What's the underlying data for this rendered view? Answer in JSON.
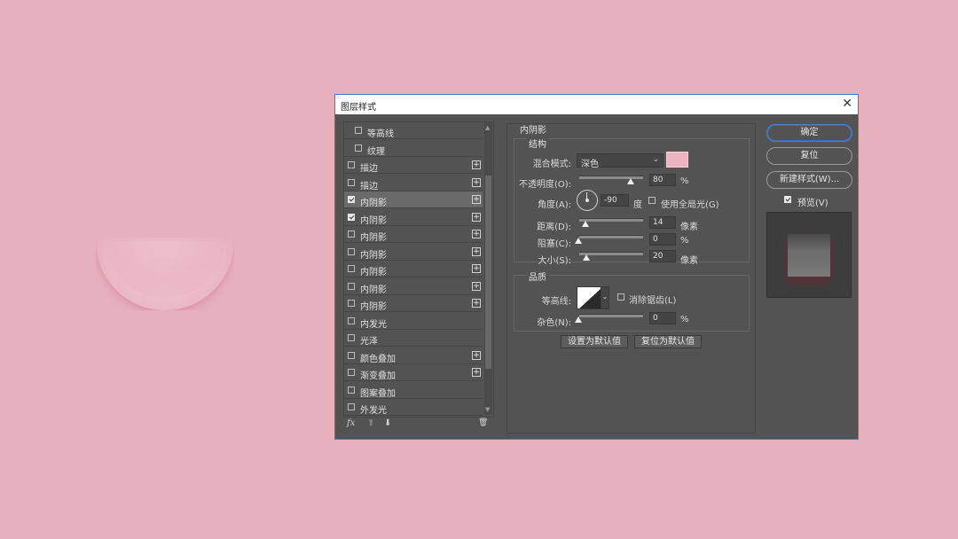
{
  "dialog": {
    "title": "图层样式",
    "close_glyph": "✕"
  },
  "style_list": {
    "items": [
      {
        "label": "等高线",
        "checked": false,
        "indent": true,
        "plus": false,
        "selected": false
      },
      {
        "label": "纹理",
        "checked": false,
        "indent": true,
        "plus": false,
        "selected": false
      },
      {
        "label": "描边",
        "checked": false,
        "indent": false,
        "plus": true,
        "selected": false
      },
      {
        "label": "描边",
        "checked": false,
        "indent": false,
        "plus": true,
        "selected": false
      },
      {
        "label": "内阴影",
        "checked": true,
        "indent": false,
        "plus": true,
        "selected": true
      },
      {
        "label": "内阴影",
        "checked": true,
        "indent": false,
        "plus": true,
        "selected": false
      },
      {
        "label": "内阴影",
        "checked": false,
        "indent": false,
        "plus": true,
        "selected": false
      },
      {
        "label": "内阴影",
        "checked": false,
        "indent": false,
        "plus": true,
        "selected": false
      },
      {
        "label": "内阴影",
        "checked": false,
        "indent": false,
        "plus": true,
        "selected": false
      },
      {
        "label": "内阴影",
        "checked": false,
        "indent": false,
        "plus": true,
        "selected": false
      },
      {
        "label": "内阴影",
        "checked": false,
        "indent": false,
        "plus": true,
        "selected": false
      },
      {
        "label": "内发光",
        "checked": false,
        "indent": false,
        "plus": false,
        "selected": false
      },
      {
        "label": "光泽",
        "checked": false,
        "indent": false,
        "plus": false,
        "selected": false
      },
      {
        "label": "颜色叠加",
        "checked": false,
        "indent": false,
        "plus": true,
        "selected": false
      },
      {
        "label": "渐变叠加",
        "checked": false,
        "indent": false,
        "plus": true,
        "selected": false
      },
      {
        "label": "图案叠加",
        "checked": false,
        "indent": false,
        "plus": false,
        "selected": false
      },
      {
        "label": "外发光",
        "checked": false,
        "indent": false,
        "plus": false,
        "selected": false
      }
    ],
    "plus_glyph": "+",
    "footer": {
      "fx_label": "fx",
      "up_glyph": "⬆",
      "down_glyph": "⬇",
      "trash_glyph": "🗑"
    }
  },
  "inner_shadow": {
    "heading": "内阴影",
    "structure_heading": "结构",
    "blend_mode_label": "混合模式:",
    "blend_mode_value": "深色",
    "shadow_color": "#efb3bf",
    "opacity_label": "不透明度(O):",
    "opacity_value": "80",
    "opacity_fraction": 0.8,
    "percent": "%",
    "angle_label": "角度(A):",
    "angle_value": "-90",
    "degree_unit": "度",
    "global_light_label": "使用全局光(G)",
    "distance_label": "距离(D):",
    "distance_value": "14",
    "choke_label": "阻塞(C):",
    "choke_value": "0",
    "size_label": "大小(S):",
    "size_value": "20",
    "pixel_unit": "像素",
    "quality_heading": "品质",
    "contour_label": "等高线:",
    "anti_alias_label": "消除锯齿(L)",
    "noise_label": "杂色(N):",
    "noise_value": "0",
    "set_default_label": "设置为默认值",
    "reset_default_label": "复位为默认值"
  },
  "right": {
    "ok_label": "确定",
    "reset_label": "复位",
    "new_style_label": "新建样式(W)...",
    "preview_label": "预览(V)",
    "preview_checked": true
  }
}
